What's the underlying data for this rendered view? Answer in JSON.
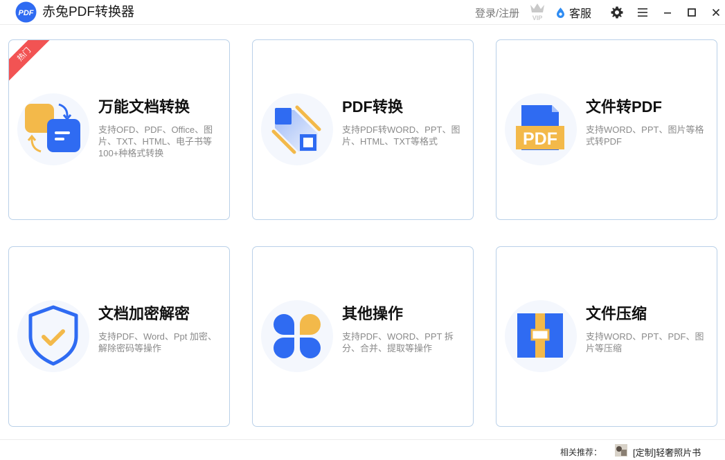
{
  "app": {
    "title": "赤兔PDF转换器",
    "logo_text": "PDF"
  },
  "header": {
    "login_label": "登录/注册",
    "vip_label": "VIP",
    "service_label": "客服"
  },
  "colors": {
    "primary_blue": "#2f6bf2",
    "accent_yellow": "#f3b94a",
    "hot_red": "#f25353",
    "card_border": "#b9d0e8"
  },
  "cards": [
    {
      "title": "万能文档转换",
      "desc": "支持OFD、PDF、Office、图片、TXT、HTML、电子书等100+种格式转换",
      "badge": "热门",
      "icon": "universal-convert-icon"
    },
    {
      "title": "PDF转换",
      "desc": "支持PDF转WORD、PPT、图片、HTML、TXT等格式",
      "icon": "pdf-convert-icon"
    },
    {
      "title": "文件转PDF",
      "desc": "支持WORD、PPT、图片等格式转PDF",
      "icon": "file-to-pdf-icon",
      "icon_text": "PDF"
    },
    {
      "title": "文档加密解密",
      "desc": "支持PDF、Word、Ppt 加密、解除密码等操作",
      "icon": "shield-check-icon"
    },
    {
      "title": "其他操作",
      "desc": "支持PDF、WORD、PPT 拆分、合并、提取等操作",
      "icon": "petals-icon"
    },
    {
      "title": "文件压缩",
      "desc": "支持WORD、PPT、PDF、图片等压缩",
      "icon": "zip-compress-icon"
    }
  ],
  "footer": {
    "rec_label": "相关推荐：",
    "rec_link": "[定制]轻奢照片书"
  }
}
